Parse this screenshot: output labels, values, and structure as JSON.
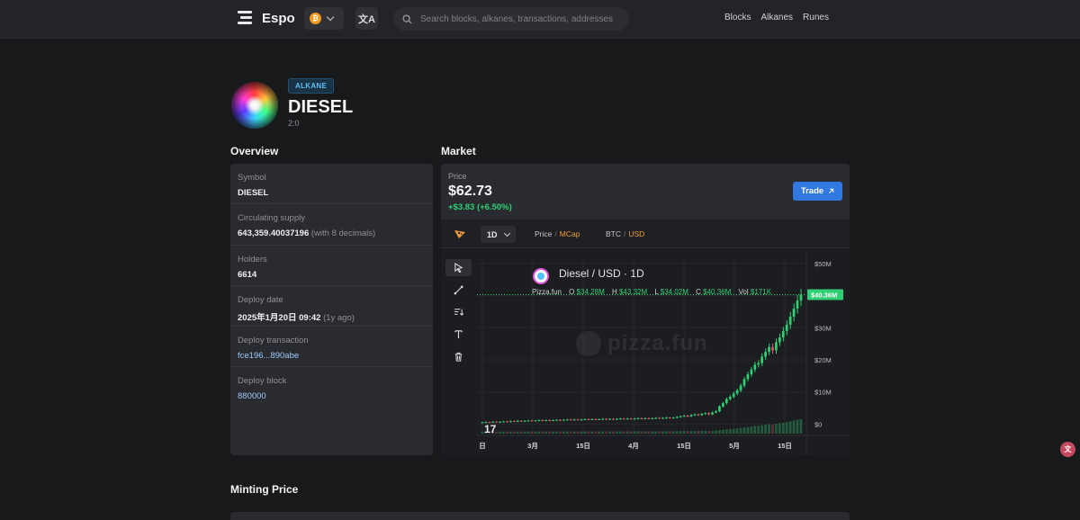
{
  "nav": {
    "brand": "Espo",
    "network_icon": "bitcoin-icon",
    "network_glyph": "₿",
    "translate_glyph": "文A",
    "search_placeholder": "Search blocks, alkanes, transactions, addresses",
    "links": [
      "Blocks",
      "Alkanes",
      "Runes"
    ]
  },
  "token": {
    "type_badge": "ALKANE",
    "name": "DIESEL",
    "id": "2:0"
  },
  "overview": {
    "title": "Overview",
    "rows": [
      {
        "label": "Symbol",
        "value": "DIESEL",
        "suffix": ""
      },
      {
        "label": "Circulating supply",
        "value": "643,359.40037196",
        "suffix": "(with 8 decimals)"
      },
      {
        "label": "Holders",
        "value": "6614",
        "suffix": ""
      },
      {
        "label": "Deploy date",
        "value": "2025年1月20日 09:42",
        "suffix": "(1y ago)"
      },
      {
        "label": "Deploy transaction",
        "value": "fce196...890abe",
        "suffix": ""
      },
      {
        "label": "Deploy block",
        "value": "880000",
        "suffix": ""
      }
    ]
  },
  "market": {
    "title": "Market",
    "price_label": "Price",
    "price": "$62.73",
    "change": "+$3.83 (+6.50%)",
    "trade_label": "Trade",
    "timeframe": "1D",
    "price_opt": "Price",
    "mcap_opt": "MCap",
    "btc_opt": "BTC",
    "usd_opt": "USD",
    "chart_title": "Diesel / USD · 1D",
    "source": "Pizza.fun",
    "ohlc": {
      "o": "$34.28M",
      "h": "$43.32M",
      "l": "$34.02M",
      "c": "$40.36M",
      "vol": "$171K"
    },
    "watermark": "pizza.fun",
    "tv_logo": "17",
    "accent": "#f29d2f",
    "up_color": "#2fcf73",
    "down_color": "#e0566a"
  },
  "chart_data": {
    "type": "line",
    "title": "Diesel / USD · 1D",
    "y_ticks": [
      "$50M",
      "$40M",
      "$30M",
      "$20M",
      "$10M",
      "$0"
    ],
    "y_tick_values": [
      50,
      40,
      30,
      20,
      10,
      0
    ],
    "ylim": [
      -3,
      52
    ],
    "last_value_label": "$40.36M",
    "last_value": 40.36,
    "x_ticks": [
      "日",
      "3月",
      "15日",
      "4月",
      "15日",
      "5月",
      "15日"
    ],
    "series": [
      {
        "values": [
          0.5,
          0.6,
          0.5,
          0.7,
          0.6,
          0.7,
          0.8,
          0.7,
          0.9,
          0.8,
          1.0,
          0.9,
          1.0,
          1.1,
          1.0,
          1.1,
          1.2,
          1.1,
          1.2,
          1.1,
          1.2,
          1.3,
          1.2,
          1.3,
          1.4,
          1.3,
          1.4,
          1.3,
          1.4,
          1.5,
          1.4,
          1.5,
          1.4,
          1.5,
          1.6,
          1.5,
          1.6,
          1.5,
          1.6,
          1.7,
          1.6,
          1.7,
          1.6,
          1.7,
          1.8,
          1.7,
          1.8,
          1.7,
          1.8,
          1.9,
          1.8,
          1.9,
          2.0,
          1.9,
          2.0,
          2.2,
          2.4,
          2.6,
          2.4,
          2.8,
          3.0,
          2.8,
          3.2,
          3.4,
          3.0,
          3.6,
          4.0,
          5.5,
          6.5,
          7.8,
          8.5,
          9.5,
          10.5,
          12.0,
          14.0,
          15.5,
          17.0,
          18.5,
          19.0,
          21.0,
          22.5,
          24.0,
          23.0,
          25.5,
          27.0,
          29.0,
          31.0,
          33.5,
          36.0,
          38.5,
          40.36
        ]
      }
    ],
    "volume_bars": true,
    "grid": true,
    "legend": "none"
  },
  "minting": {
    "title": "Minting Price"
  },
  "side_widget_glyph": "文"
}
